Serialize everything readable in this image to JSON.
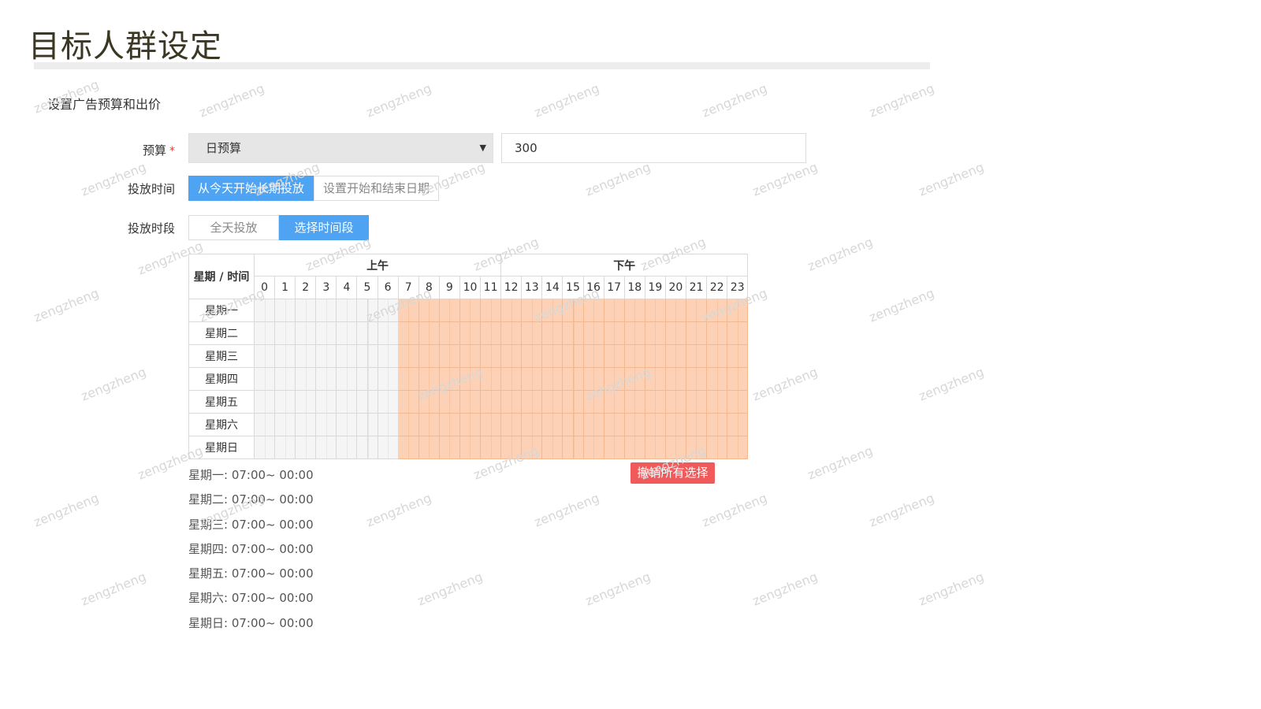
{
  "page": {
    "title": "目标人群设定"
  },
  "section": {
    "title": "设置广告预算和出价"
  },
  "budget": {
    "label": "预算",
    "required_mark": "*",
    "type_selected": "日预算",
    "amount": "300"
  },
  "delivery_time": {
    "label": "投放时间",
    "options": [
      "从今天开始长期投放",
      "设置开始和结束日期"
    ],
    "active_index": 0
  },
  "delivery_period": {
    "label": "投放时段",
    "options": [
      "全天投放",
      "选择时间段"
    ],
    "active_index": 1
  },
  "schedule": {
    "corner_label": "星期 / 时间",
    "am_label": "上午",
    "pm_label": "下午",
    "hours": [
      "0",
      "1",
      "2",
      "3",
      "4",
      "5",
      "6",
      "7",
      "8",
      "9",
      "10",
      "11",
      "12",
      "13",
      "14",
      "15",
      "16",
      "17",
      "18",
      "19",
      "20",
      "21",
      "22",
      "23"
    ],
    "days": [
      "星期一",
      "星期二",
      "星期三",
      "星期四",
      "星期五",
      "星期六",
      "星期日"
    ],
    "selected_start_hour": 7,
    "selected_end_hour": 24,
    "selected_color": "#fcd1b5"
  },
  "summary": [
    "星期一: 07:00~ 00:00",
    "星期二: 07:00~ 00:00",
    "星期三: 07:00~ 00:00",
    "星期四: 07:00~ 00:00",
    "星期五: 07:00~ 00:00",
    "星期六: 07:00~ 00:00",
    "星期日: 07:00~ 00:00"
  ],
  "cancel_button": {
    "label": "撤销所有选择",
    "color": "#f15a5a"
  },
  "watermark": {
    "text": "zengzheng"
  },
  "colors": {
    "accent": "#4fa3f3",
    "title": "#3b3722"
  }
}
